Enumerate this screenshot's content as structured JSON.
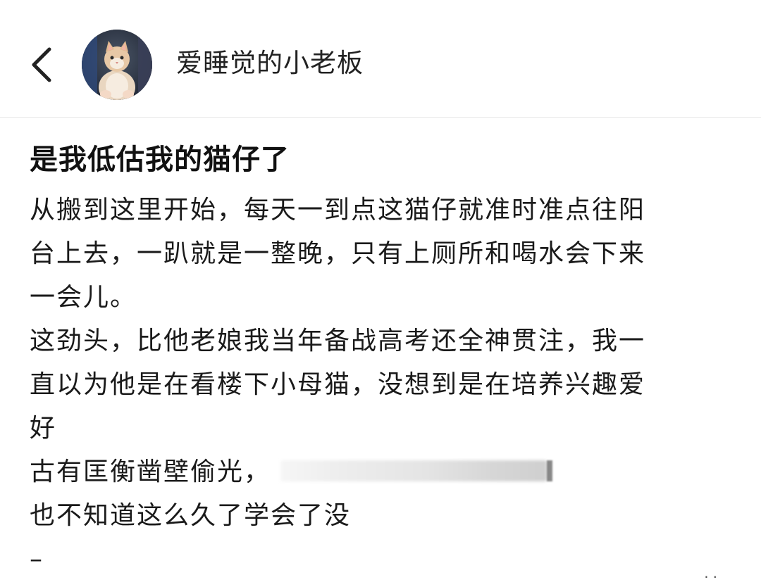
{
  "header": {
    "back_icon": "chevron-left-icon",
    "avatar_alt": "cat-avatar",
    "username": "爱睡觉的小老板"
  },
  "post": {
    "title": "是我低估我的猫仔了",
    "lines": [
      "从搬到这里开始，每天一到点这猫仔就准时准点往阳",
      "台上去，一趴就是一整晚，只有上厕所和喝水会下来",
      "一会儿。",
      "这劲头，比他老娘我当年备战高考还全神贯注，我一",
      "直以为他是在看楼下小母猫，没想到是在培养兴趣爱",
      "好",
      "古有匡衡凿壁偷光，",
      "也不知道这么久了学会了没",
      "–"
    ]
  },
  "footer": {
    "dots": "··"
  }
}
